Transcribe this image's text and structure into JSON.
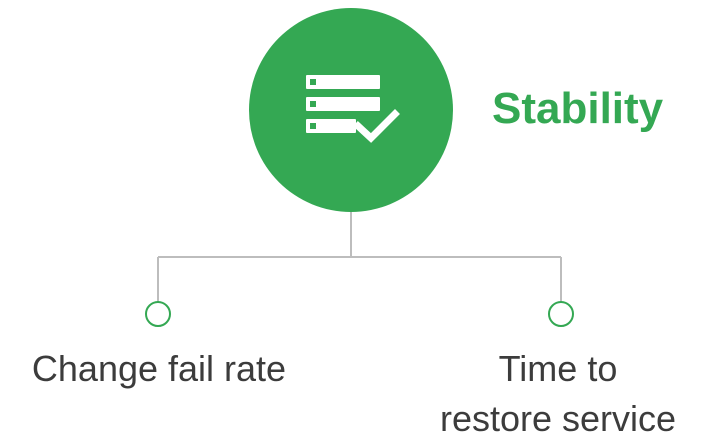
{
  "colors": {
    "accent": "#34a853",
    "connector": "#bdbdbd",
    "text": "#3c3c3c",
    "icon": "#ffffff"
  },
  "diagram": {
    "main_node": {
      "title": "Stability",
      "icon": "server-check-icon"
    },
    "children": [
      {
        "label": "Change fail rate"
      },
      {
        "label_lines": [
          "Time to",
          "restore service"
        ]
      }
    ]
  }
}
